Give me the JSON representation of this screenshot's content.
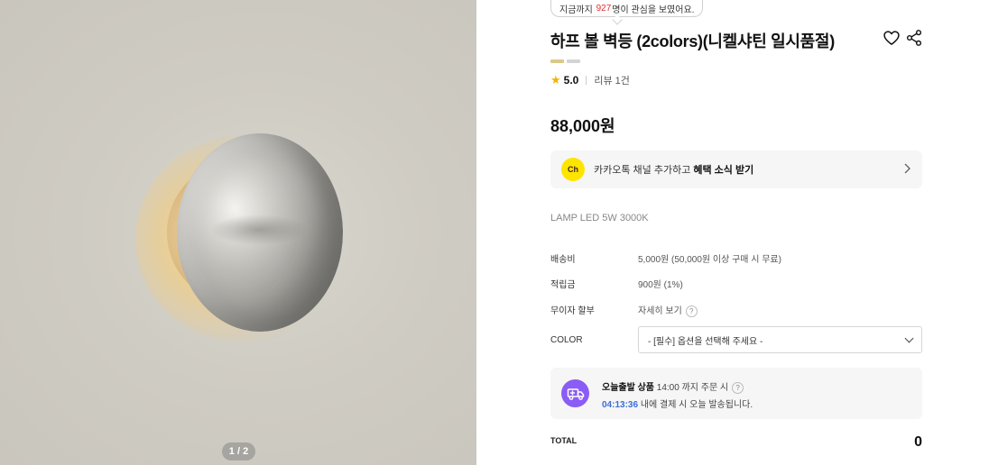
{
  "image": {
    "pager": "1 / 2"
  },
  "tooltip": {
    "prefix": "지금까지",
    "count": "927",
    "suffix": "명이 관심을 보였어요."
  },
  "product": {
    "title": "하프 볼 벽등 (2colors)(니켈샤틴 일시품절)",
    "swatch_colors": [
      "#d9c98a",
      "#d4d4d4"
    ],
    "rating_score": "5.0",
    "reviews": "리뷰 1건",
    "price": "88,000원",
    "spec": "LAMP LED 5W 3000K"
  },
  "kakao": {
    "icon_text": "Ch",
    "text": "카카오톡 채널 추가하고",
    "bold": "혜택 소식 받기"
  },
  "info": {
    "shipping_label": "배송비",
    "shipping_value": "5,000원 (50,000원 이상 구매 시 무료)",
    "points_label": "적립금",
    "points_value": "900원 (1%)",
    "installment_label": "무이자 할부",
    "installment_value": "자세히 보기",
    "color_label": "COLOR",
    "color_placeholder": "- [필수] 옵션을 선택해 주세요 -"
  },
  "delivery": {
    "title": "오늘출발 상품",
    "cutoff": "14:00 까지 주문 시",
    "timer": "04:13:36",
    "message": "내에 결제 시 오늘 발송됩니다."
  },
  "total": {
    "label": "TOTAL",
    "value": "0"
  },
  "icons": {
    "wish": "heart-icon",
    "share": "share-icon",
    "help": "question-icon",
    "delivery": "truck-icon"
  }
}
